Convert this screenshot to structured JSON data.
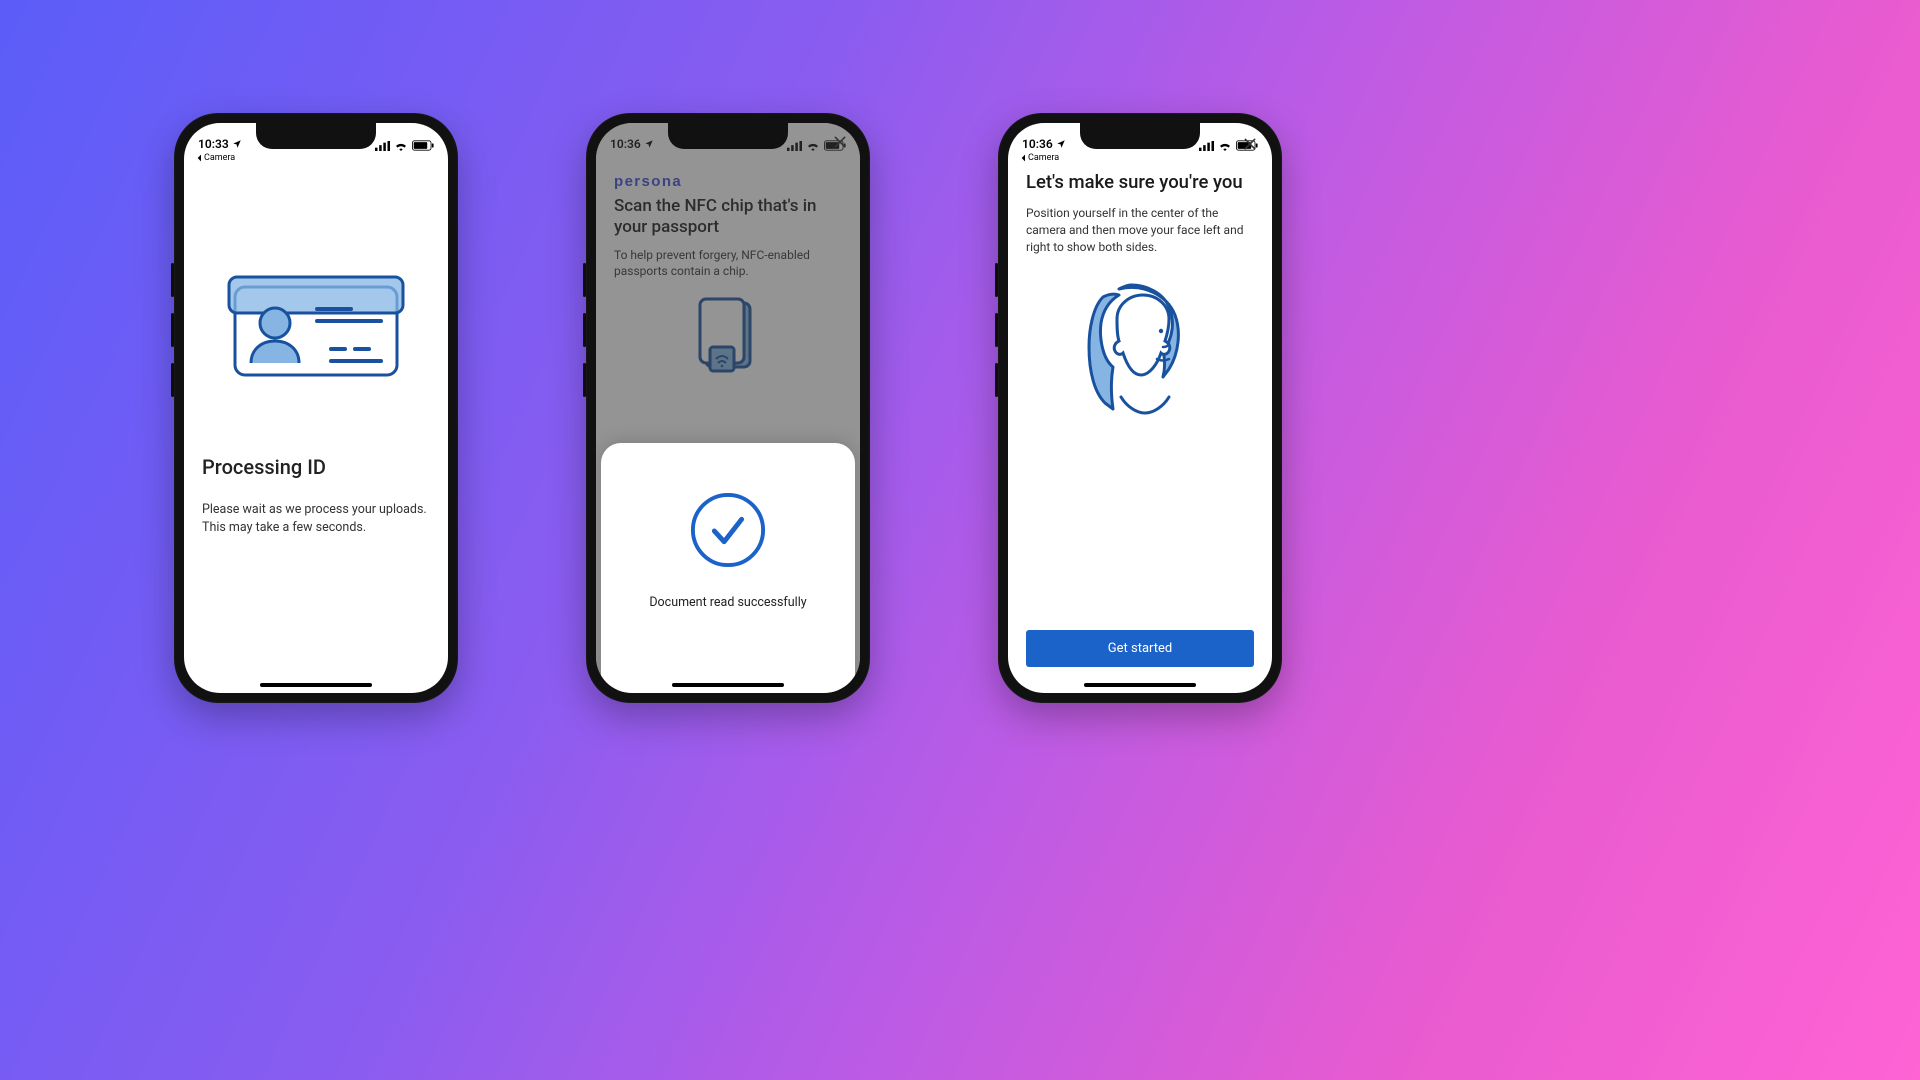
{
  "colors": {
    "accent": "#1b62c9",
    "stroke": "#18529e",
    "fill": "#86b5e4"
  },
  "phones": [
    {
      "status": {
        "time": "10:33",
        "breadcrumb": "Camera"
      },
      "title": "Processing ID",
      "body": "Please wait as we process your uploads. This may take a few seconds."
    },
    {
      "status": {
        "time": "10:36",
        "breadcrumb": ""
      },
      "brand": "persona",
      "title": "Scan the NFC chip that's in your passport",
      "body": "To help prevent forgery, NFC-enabled passports contain a chip.",
      "sheet_text": "Document read successfully",
      "close_label": "Close"
    },
    {
      "status": {
        "time": "10:36",
        "breadcrumb": "Camera"
      },
      "title": "Let's make sure you're you",
      "body": "Position yourself in the center of the camera and then move your face left and right to show both sides.",
      "cta": "Get started",
      "close_label": "Close"
    }
  ]
}
